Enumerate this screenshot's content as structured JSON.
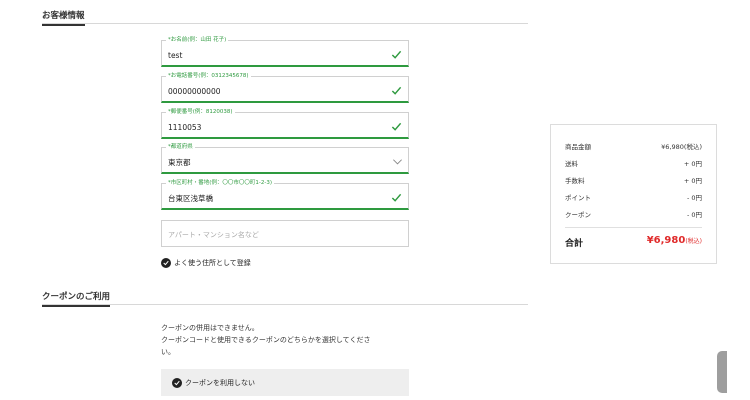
{
  "customer_section": {
    "title": "お客様情報"
  },
  "fields": {
    "name": {
      "label": "*お名前(例：山田 花子)",
      "value": "test"
    },
    "phone": {
      "label": "*お電話番号(例：0312345678)",
      "value": "00000000000"
    },
    "postal": {
      "label": "*郵便番号(例：8120038)",
      "value": "1110053"
    },
    "prefecture": {
      "label": "*都道府県",
      "value": "東京都"
    },
    "address": {
      "label": "*市区町村・番地(例：〇〇市〇〇町1-2-3)",
      "value": "台東区浅草橋"
    },
    "building": {
      "placeholder": "アパート・マンション名など"
    }
  },
  "register": {
    "label": "よく使う住所として登録"
  },
  "coupon_section": {
    "title": "クーポンのご利用",
    "line1": "クーポンの併用はできません。",
    "line2": "クーポンコードと使用できるクーポンのどちらかを選択してくださ",
    "line3": "い。",
    "option": "クーポンを利用しない"
  },
  "summary": {
    "rows": [
      {
        "label": "商品金額",
        "value": "¥6,980(税込)"
      },
      {
        "label": "送料",
        "value": "+ 0円"
      },
      {
        "label": "手数料",
        "value": "+ 0円"
      },
      {
        "label": "ポイント",
        "value": "- 0円"
      },
      {
        "label": "クーポン",
        "value": "- 0円"
      }
    ],
    "total_label": "合計",
    "total_value": "¥6,980",
    "total_suffix": "(税込)"
  },
  "colors": {
    "accent_green": "#2e9a3f",
    "total_red": "#e02a2a"
  }
}
